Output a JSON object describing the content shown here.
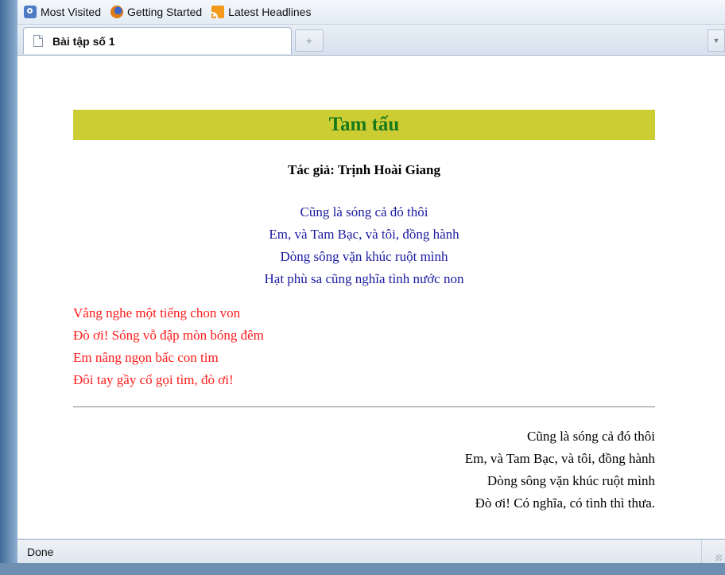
{
  "bookmarks": {
    "items": [
      {
        "label": "Most Visited",
        "icon": "most-visited-icon"
      },
      {
        "label": "Getting Started",
        "icon": "firefox-icon"
      },
      {
        "label": "Latest Headlines",
        "icon": "rss-feed-icon"
      }
    ]
  },
  "tabs": {
    "active_label": "Bài tập số 1",
    "new_tab_glyph": "+",
    "list_glyph": "▼"
  },
  "poem": {
    "title": "Tam tấu",
    "author": "Tác giả: Trịnh Hoài Giang",
    "stanza1": [
      "Cũng là sóng cả đó thôi",
      "Em, và Tam Bạc, và tôi, đồng hành",
      "Dòng sông vặn khúc ruột mình",
      "Hạt phù sa cũng nghĩa tình nước non"
    ],
    "stanza2": [
      "Vẳng nghe một tiếng chon von",
      "Đò ơi! Sóng vỗ đập mòn bóng đêm",
      "Em nâng ngọn bấc con tim",
      "Đôi tay gầy cố gọi tìm, đò ơi!"
    ],
    "stanza3": [
      "Cũng là sóng cả đó thôi",
      "Em, và Tam Bạc, và tôi, đồng hành",
      "Dòng sông vặn khúc ruột mình",
      "Đò ơi! Có nghĩa, có tình thì thưa."
    ]
  },
  "status": {
    "text": "Done"
  },
  "colors": {
    "title_background": "#cccc33",
    "title_text": "#1a7a1a",
    "stanza1_text": "#1a1aa0",
    "stanza2_text": "#ff1a1a",
    "stanza3_text": "#000000"
  }
}
